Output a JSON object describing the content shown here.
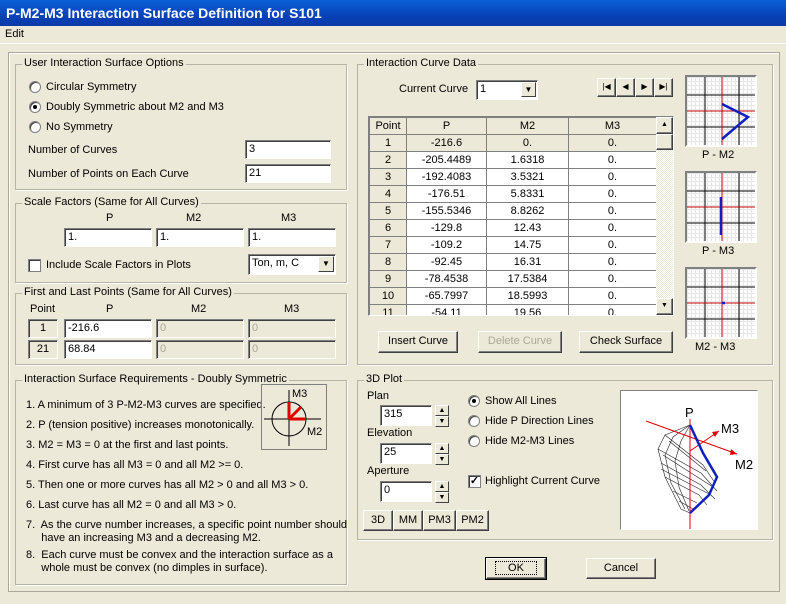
{
  "window": {
    "title": "P-M2-M3 Interaction Surface Definition for S101"
  },
  "menu": {
    "edit": "Edit"
  },
  "options": {
    "legend": "User Interaction Surface Options",
    "radios": [
      {
        "label": "Circular Symmetry",
        "selected": false
      },
      {
        "label": "Doubly Symmetric about M2 and M3",
        "selected": true
      },
      {
        "label": "No Symmetry",
        "selected": false
      }
    ],
    "num_curves_label": "Number of Curves",
    "num_curves": "3",
    "num_points_label": "Number of Points on Each Curve",
    "num_points": "21"
  },
  "scale": {
    "legend": "Scale Factors (Same for All Curves)",
    "col_p": "P",
    "col_m2": "M2",
    "col_m3": "M3",
    "p": "1.",
    "m2": "1.",
    "m3": "1.",
    "include_label": "Include Scale Factors in Plots",
    "include_checked": false,
    "units": "Ton, m, C"
  },
  "endpoints": {
    "legend": "First and Last Points (Same for All Curves)",
    "col_point": "Point",
    "col_p": "P",
    "col_m2": "M2",
    "col_m3": "M3",
    "rows": [
      {
        "point": "1",
        "p": "-216.6",
        "m2": "0",
        "m3": "0"
      },
      {
        "point": "21",
        "p": "68.84",
        "m2": "0",
        "m3": "0"
      }
    ]
  },
  "requirements": {
    "legend": "Interaction Surface Requirements - Doubly Symmetric",
    "axis_m3": "M3",
    "axis_m2": "M2",
    "items": [
      "1.  A minimum of 3 P-M2-M3 curves are specified.",
      "2.  P (tension positive) increases monotonically.",
      "3.  M2 = M3 = 0 at the first and last points.",
      "4.  First curve has all M3 = 0 and all M2 >= 0.",
      "5.  Then one or more curves has all M2 > 0 and all M3 > 0.",
      "6.  Last curve has all M2 = 0 and all M3 > 0.",
      "7.  As the curve number increases, a specific point number should",
      "     have an increasing M3 and a decreasing M2.",
      "8.  Each curve must be convex and the interaction surface as a",
      "     whole must be convex (no dimples in surface)."
    ]
  },
  "curve_data": {
    "legend": "Interaction Curve Data",
    "current_curve_label": "Current Curve",
    "current_curve": "1",
    "columns": [
      "Point",
      "P",
      "M2",
      "M3"
    ],
    "rows": [
      [
        "1",
        "-216.6",
        "0.",
        "0."
      ],
      [
        "2",
        "-205.4489",
        "1.6318",
        "0."
      ],
      [
        "3",
        "-192.4083",
        "3.5321",
        "0."
      ],
      [
        "4",
        "-176.51",
        "5.8331",
        "0."
      ],
      [
        "5",
        "-155.5346",
        "8.8262",
        "0."
      ],
      [
        "6",
        "-129.8",
        "12.43",
        "0."
      ],
      [
        "7",
        "-109.2",
        "14.75",
        "0."
      ],
      [
        "8",
        "-92.45",
        "16.31",
        "0."
      ],
      [
        "9",
        "-78.4538",
        "17.5384",
        "0."
      ],
      [
        "10",
        "-65.7997",
        "18.5993",
        "0."
      ],
      [
        "11",
        "-54.11",
        "19.56",
        "0."
      ]
    ],
    "insert": "Insert Curve",
    "delete": "Delete Curve",
    "check": "Check Surface",
    "mini_plots": [
      "P - M2",
      "P - M3",
      "M2 - M3"
    ]
  },
  "plot3d": {
    "legend": "3D Plot",
    "plan_label": "Plan",
    "plan": "315",
    "elevation_label": "Elevation",
    "elevation": "25",
    "aperture_label": "Aperture",
    "aperture": "0",
    "views": [
      "3D",
      "MM",
      "PM3",
      "PM2"
    ],
    "line_options": [
      {
        "label": "Show All Lines",
        "selected": true
      },
      {
        "label": "Hide P Direction Lines",
        "selected": false
      },
      {
        "label": "Hide M2-M3 Lines",
        "selected": false
      }
    ],
    "highlight_label": "Highlight Current Curve",
    "highlight_checked": true,
    "axis_p": "P",
    "axis_m3": "M3",
    "axis_m2": "M2"
  },
  "buttons": {
    "ok": "OK",
    "cancel": "Cancel"
  },
  "colors": {
    "title_bar": "#0842b8",
    "axis_red": "#e00000",
    "curve_blue": "#1020c0"
  }
}
